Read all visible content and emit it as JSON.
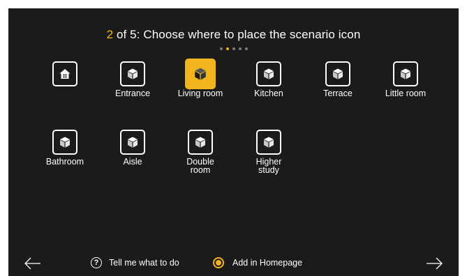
{
  "header": {
    "step": "2",
    "title_rest": " of 5: Choose where to place the scenario icon",
    "total_steps": 5,
    "current_step": 2
  },
  "rooms": [
    {
      "id": "home",
      "label": "",
      "icon": "home-icon",
      "selected": false
    },
    {
      "id": "entrance",
      "label": "Entrance",
      "icon": "cube-icon",
      "selected": false
    },
    {
      "id": "living-room",
      "label": "Living room",
      "icon": "cube-icon",
      "selected": true
    },
    {
      "id": "kitchen",
      "label": "Kitchen",
      "icon": "cube-icon",
      "selected": false
    },
    {
      "id": "terrace",
      "label": "Terrace",
      "icon": "cube-icon",
      "selected": false
    },
    {
      "id": "little-room",
      "label": "Little room",
      "icon": "cube-icon",
      "selected": false
    },
    {
      "id": "bathroom",
      "label": "Bathroom",
      "icon": "cube-icon",
      "selected": false
    },
    {
      "id": "aisle",
      "label": "Aisle",
      "icon": "cube-icon",
      "selected": false
    },
    {
      "id": "double-room",
      "label": "Double\nroom",
      "icon": "cube-icon",
      "selected": false
    },
    {
      "id": "higher-study",
      "label": "Higher\nstudy",
      "icon": "cube-icon",
      "selected": false
    }
  ],
  "footer": {
    "help_label": "Tell me what to do",
    "home_label": "Add in Homepage",
    "add_in_homepage": true
  },
  "colors": {
    "background": "#1b1b1b",
    "accent": "#f2b51d",
    "text": "#ffffff"
  }
}
